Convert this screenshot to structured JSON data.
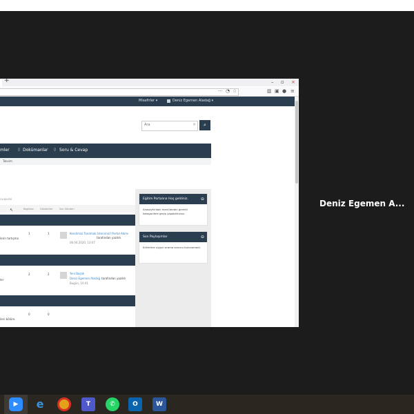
{
  "meeting": {
    "participant_name": "Deniz Egemen A..."
  },
  "browser": {
    "new_tab": "+",
    "min": "–",
    "max": "▫",
    "close": "×"
  },
  "site": {
    "nav_misafir": "Misafirler ▾",
    "nav_user": "Deniz Egemen Aladağ ▾",
    "search_placeholder": "Ara",
    "search_btn": "⌕",
    "main_nav": [
      "mler",
      "Dokümanlar",
      "Soru & Cevap"
    ],
    "sub_item": "Takvim",
    "breadcrumb_small": "OLOJİLERİ",
    "columns": [
      "Başlıklar",
      "Gönderiler",
      "Son Gönderi"
    ],
    "rows": [
      {
        "left": "lerin tartışma",
        "topics": "1",
        "posts": "1",
        "last_title": "Kendimizi Tanıtmak İstersiniz? Portal Adımı",
        "last_by": "tarafından yazıldı",
        "last_date": "06.04.2020, 13:07"
      },
      {
        "left": "ler",
        "topics": "2",
        "posts": "2",
        "last_title": "Yeni Başlık",
        "last_user": "Deniz Egemen Aladağ",
        "last_by": "tarafından yazıldı",
        "last_date": "Bugün, 10:41"
      },
      {
        "left": "ileri bölüm.",
        "topics": "0",
        "posts": "0"
      }
    ],
    "widget1_title": "Eğitim Portalına Hoş geldiniz.",
    "widget1_body": "Anasayfa'daki menülerden gerekli kategorilere geçiş yapabilirsiniz.",
    "widget2_title": "Son Paylaşımlar",
    "widget2_body": "Kriterlere uygun arama sonucu bulunamadı."
  },
  "taskbar": {
    "apps": [
      "zoom-icon",
      "edge-icon",
      "chrome-icon",
      "teams-icon",
      "whatsapp-icon",
      "outlook-icon",
      "word-icon"
    ]
  }
}
